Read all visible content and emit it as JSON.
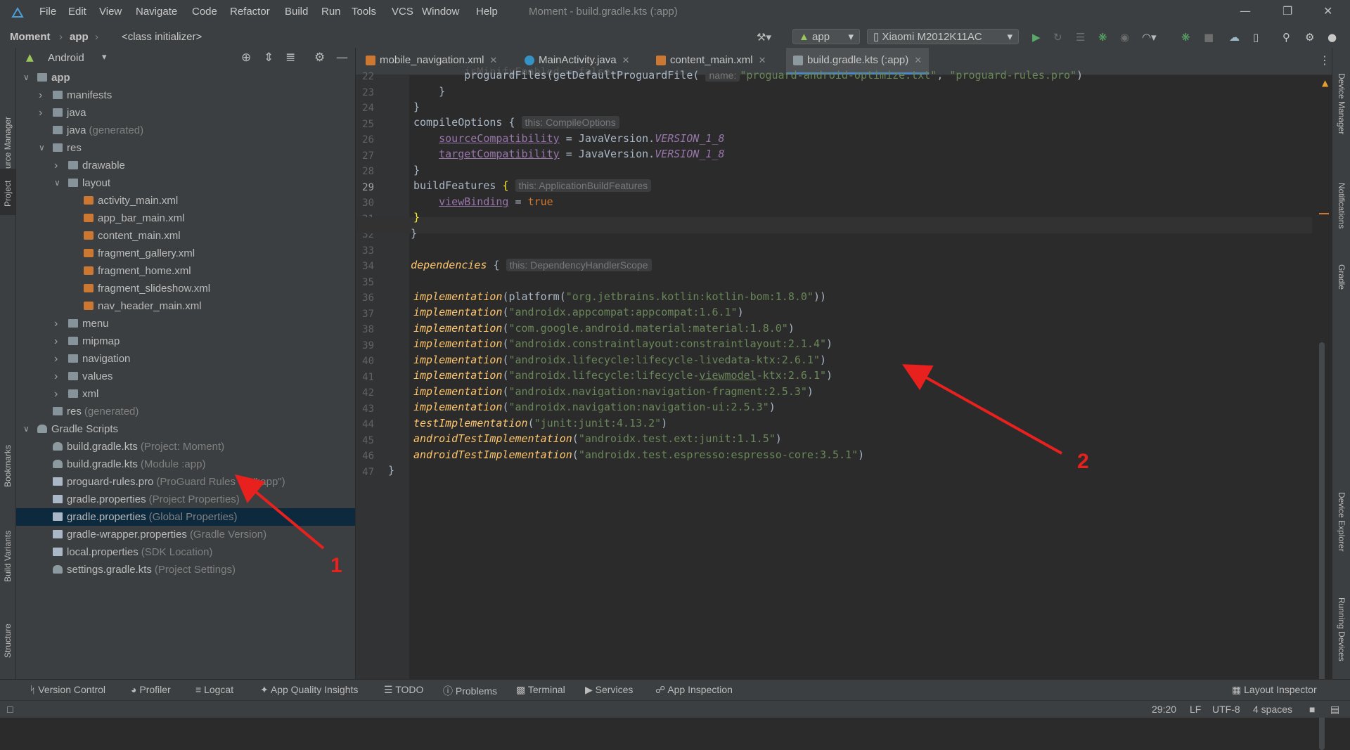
{
  "menu": [
    "File",
    "Edit",
    "View",
    "Navigate",
    "Code",
    "Refactor",
    "Build",
    "Run",
    "Tools",
    "VCS",
    "Window",
    "Help"
  ],
  "window_title": "Moment - build.gradle.kts (:app)",
  "breadcrumb": {
    "project": "Moment",
    "module": "app",
    "scope": "<class initializer>"
  },
  "toolbar": {
    "run_config": "app",
    "device": "Xiaomi M2012K11AC"
  },
  "left_tools": [
    "Resource Manager",
    "Project",
    "Bookmarks",
    "Build Variants",
    "Structure"
  ],
  "right_tools": [
    "Device Manager",
    "Notifications",
    "Gradle",
    "Device Explorer",
    "Running Devices"
  ],
  "project": {
    "view": "Android",
    "tree": [
      {
        "label": "app",
        "hint": "",
        "bold": true
      },
      {
        "label": "manifests",
        "hint": ""
      },
      {
        "label": "java",
        "hint": ""
      },
      {
        "label": "java",
        "hint": "(generated)"
      },
      {
        "label": "res",
        "hint": ""
      },
      {
        "label": "drawable",
        "hint": ""
      },
      {
        "label": "layout",
        "hint": ""
      },
      {
        "label": "activity_main.xml",
        "hint": ""
      },
      {
        "label": "app_bar_main.xml",
        "hint": ""
      },
      {
        "label": "content_main.xml",
        "hint": ""
      },
      {
        "label": "fragment_gallery.xml",
        "hint": ""
      },
      {
        "label": "fragment_home.xml",
        "hint": ""
      },
      {
        "label": "fragment_slideshow.xml",
        "hint": ""
      },
      {
        "label": "nav_header_main.xml",
        "hint": ""
      },
      {
        "label": "menu",
        "hint": ""
      },
      {
        "label": "mipmap",
        "hint": ""
      },
      {
        "label": "navigation",
        "hint": ""
      },
      {
        "label": "values",
        "hint": ""
      },
      {
        "label": "xml",
        "hint": ""
      },
      {
        "label": "res",
        "hint": "(generated)"
      },
      {
        "label": "Gradle Scripts",
        "hint": ""
      },
      {
        "label": "build.gradle.kts",
        "hint": "(Project: Moment)"
      },
      {
        "label": "build.gradle.kts",
        "hint": "(Module :app)"
      },
      {
        "label": "proguard-rules.pro",
        "hint": "(ProGuard Rules for \":app\")"
      },
      {
        "label": "gradle.properties",
        "hint": "(Project Properties)"
      },
      {
        "label": "gradle.properties",
        "hint": "(Global Properties)"
      },
      {
        "label": "gradle-wrapper.properties",
        "hint": "(Gradle Version)"
      },
      {
        "label": "local.properties",
        "hint": "(SDK Location)"
      },
      {
        "label": "settings.gradle.kts",
        "hint": "(Project Settings)"
      }
    ]
  },
  "tabs": [
    {
      "label": "mobile_navigation.xml",
      "color": "#cc7832"
    },
    {
      "label": "MainActivity.java",
      "color": "#3592c4"
    },
    {
      "label": "content_main.xml",
      "color": "#cc7832"
    },
    {
      "label": "build.gradle.kts (:app)",
      "color": "#8c9aa0"
    }
  ],
  "editor": {
    "line_numbers": [
      "22",
      "23",
      "24",
      "25",
      "26",
      "27",
      "28",
      "29",
      "30",
      "31",
      "32",
      "33",
      "34",
      "35",
      "36",
      "37",
      "38",
      "39",
      "40",
      "41",
      "42",
      "43",
      "44",
      "45",
      "46",
      "47"
    ],
    "t": {
      "proguard": "proguardFiles(",
      "getdef": "getDefaultProguardFile(",
      "name_hint": "name:",
      "opt": "\"proguard-android-optimize.txt\"",
      "rules": "\"proguard-rules.pro\"",
      "compileOptions": "compileOptions {",
      "hint_co": "this: CompileOptions",
      "source": "sourceCompatibility",
      "target": "targetCompatibility",
      "javaver": " = JavaVersion.",
      "v18": "VERSION_1_8",
      "buildFeatures": "buildFeatures ",
      "hint_bf": "this: ApplicationBuildFeatures",
      "viewBinding": "viewBinding",
      "eq": " = ",
      "true": "true",
      "dependencies": "dependencies",
      "hint_dep": "this: DependencyHandlerScope",
      "impl": "implementation",
      "testImpl": "testImplementation",
      "atImpl": "androidTestImplementation",
      "platform": "(platform(",
      "d36": "\"org.jetbrains.kotlin:kotlin-bom:1.8.0\"",
      "d37": "\"androidx.appcompat:appcompat:1.6.1\"",
      "d38": "\"com.google.android.material:material:1.8.0\"",
      "d39": "\"androidx.constraintlayout:constraintlayout:2.1.4\"",
      "d40": "\"androidx.lifecycle:lifecycle-livedata-ktx:2.6.1\"",
      "d41a": "\"androidx.lifecycle:lifecycle-",
      "d41b": "viewmodel",
      "d41c": "-ktx:2.6.1\"",
      "d42": "\"androidx.navigation:navigation-fragment:2.5.3\"",
      "d43": "\"androidx.navigation:navigation-ui:2.5.3\"",
      "d44": "\"junit:junit:4.13.2\"",
      "d45": "\"androidx.test.ext:junit:1.1.5\"",
      "d46": "\"androidx.test.espresso:espresso-core:3.5.1\""
    }
  },
  "bottom_tools": [
    "Version Control",
    "Profiler",
    "Logcat",
    "App Quality Insights",
    "TODO",
    "Problems",
    "Terminal",
    "Services",
    "App Inspection",
    "Layout Inspector"
  ],
  "status": {
    "pos": "29:20",
    "sep": "LF",
    "enc": "UTF-8",
    "indent": "4 spaces"
  },
  "annotations": [
    "1",
    "2"
  ]
}
